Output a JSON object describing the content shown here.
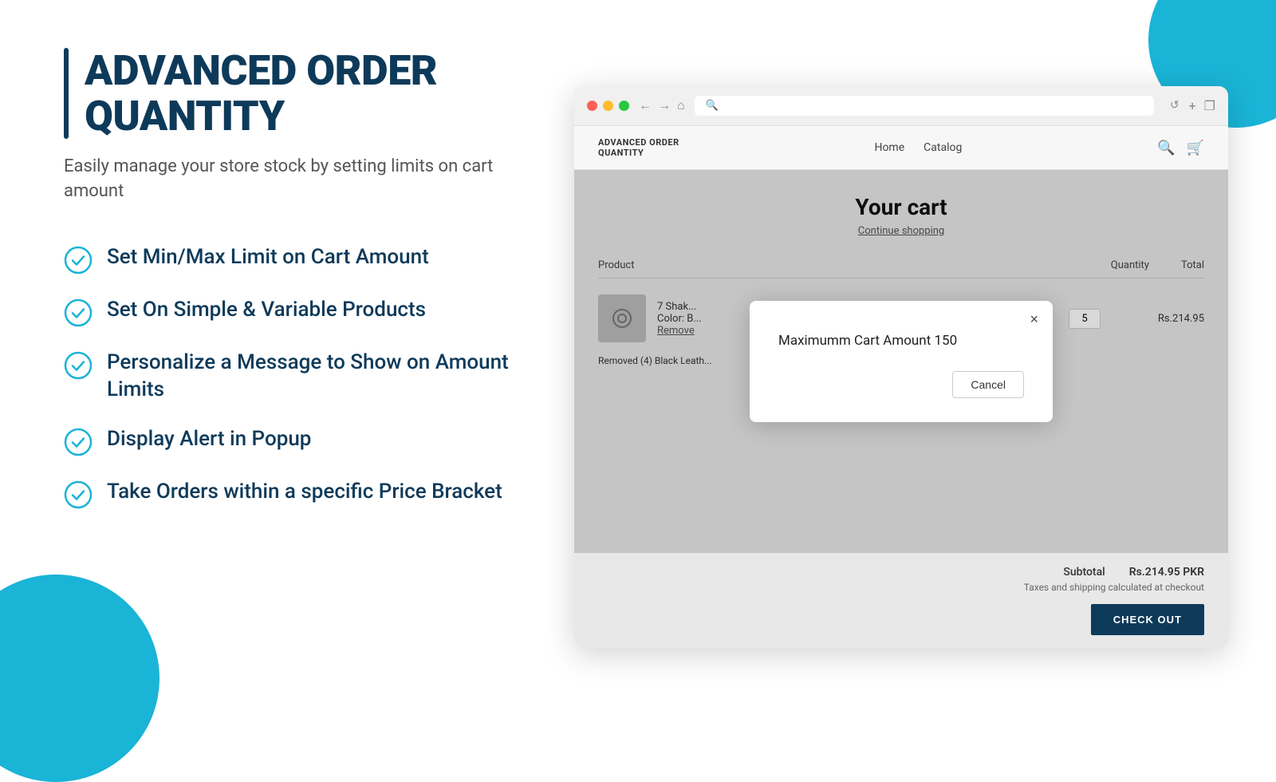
{
  "decorations": {
    "top_right": "top-right-circle",
    "bottom_left": "bottom-left-circle"
  },
  "left": {
    "title": "ADVANCED ORDER QUANTITY",
    "subtitle": "Easily manage your store stock by setting limits on cart amount",
    "features": [
      {
        "id": "f1",
        "text": "Set Min/Max Limit on Cart Amount"
      },
      {
        "id": "f2",
        "text": "Set On Simple & Variable Products"
      },
      {
        "id": "f3",
        "text": "Personalize a Message to Show on Amount Limits"
      },
      {
        "id": "f4",
        "text": "Display Alert in Popup"
      },
      {
        "id": "f5",
        "text": "Take Orders within a specific Price Bracket"
      }
    ]
  },
  "browser": {
    "address_placeholder": "Q",
    "nav": {
      "back": "←",
      "forward": "→",
      "home": "⌂",
      "refresh": "↺",
      "new_tab": "+",
      "window": "❐"
    },
    "store": {
      "brand_line1": "ADVANCED ORDER",
      "brand_line2": "QUANTITY",
      "nav_links": [
        "Home",
        "Catalog"
      ],
      "cart_title": "Your cart",
      "continue_shopping": "Continue shopping",
      "table_headers": {
        "product": "Product",
        "quantity": "Quantity",
        "total": "Total"
      },
      "product": {
        "name": "7 Shak...",
        "color": "Color: B...",
        "remove": "Remove",
        "qty": "5",
        "total": "Rs.214.95"
      },
      "removed_note": "Removed (4) Black Leath...",
      "subtotal_label": "Subtotal",
      "subtotal_value": "Rs.214.95 PKR",
      "tax_note": "Taxes and shipping calculated at checkout",
      "checkout_btn": "CHECK OUT"
    },
    "modal": {
      "message": "Maximumm Cart Amount 150",
      "cancel_btn": "Cancel",
      "close_icon": "×"
    }
  }
}
